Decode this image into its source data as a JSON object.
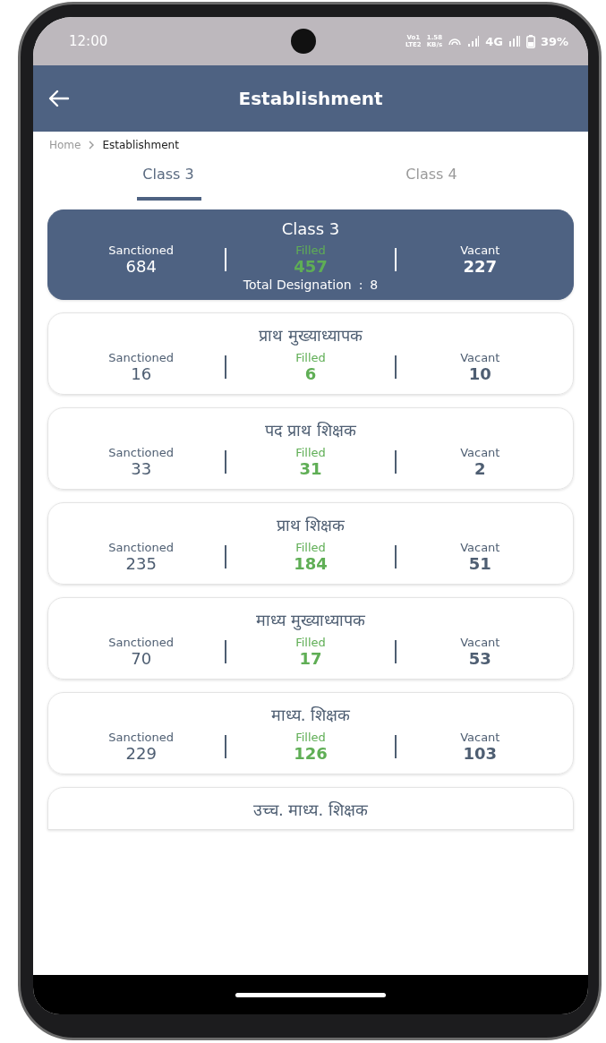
{
  "status_bar": {
    "time": "12:00",
    "volte_label": [
      "Vo1",
      "LTE2"
    ],
    "speed": [
      "1.58",
      "KB/s"
    ],
    "network_type": "4G",
    "battery": "39%"
  },
  "app_bar": {
    "title": "Establishment"
  },
  "breadcrumb": [
    {
      "label": "Home",
      "current": false
    },
    {
      "label": "Establishment",
      "current": true
    }
  ],
  "tabs": [
    {
      "label": "Class 3",
      "selected": true
    },
    {
      "label": "Class 4",
      "selected": false
    }
  ],
  "summary": {
    "title": "Class 3",
    "stats": [
      {
        "kind": "sanctioned",
        "label": "Sanctioned",
        "value": "684"
      },
      {
        "kind": "filled",
        "label": "Filled",
        "value": "457"
      },
      {
        "kind": "vacant",
        "label": "Vacant",
        "value": "227"
      }
    ],
    "total_label": "Total Designation",
    "total_separator": ":",
    "total_value": "8"
  },
  "designations": [
    {
      "title": "प्राथ मुख्याध्यापक",
      "stats": [
        {
          "kind": "sanctioned",
          "label": "Sanctioned",
          "value": "16"
        },
        {
          "kind": "filled",
          "label": "Filled",
          "value": "6"
        },
        {
          "kind": "vacant",
          "label": "Vacant",
          "value": "10"
        }
      ]
    },
    {
      "title": "पद प्राथ शिक्षक",
      "stats": [
        {
          "kind": "sanctioned",
          "label": "Sanctioned",
          "value": "33"
        },
        {
          "kind": "filled",
          "label": "Filled",
          "value": "31"
        },
        {
          "kind": "vacant",
          "label": "Vacant",
          "value": "2"
        }
      ]
    },
    {
      "title": "प्राथ शिक्षक",
      "stats": [
        {
          "kind": "sanctioned",
          "label": "Sanctioned",
          "value": "235"
        },
        {
          "kind": "filled",
          "label": "Filled",
          "value": "184"
        },
        {
          "kind": "vacant",
          "label": "Vacant",
          "value": "51"
        }
      ]
    },
    {
      "title": "माध्य मुख्याध्यापक",
      "stats": [
        {
          "kind": "sanctioned",
          "label": "Sanctioned",
          "value": "70"
        },
        {
          "kind": "filled",
          "label": "Filled",
          "value": "17"
        },
        {
          "kind": "vacant",
          "label": "Vacant",
          "value": "53"
        }
      ]
    },
    {
      "title": "माध्य. शिक्षक",
      "stats": [
        {
          "kind": "sanctioned",
          "label": "Sanctioned",
          "value": "229"
        },
        {
          "kind": "filled",
          "label": "Filled",
          "value": "126"
        },
        {
          "kind": "vacant",
          "label": "Vacant",
          "value": "103"
        }
      ]
    },
    {
      "title": "उच्च. माध्य. शिक्षक"
    }
  ]
}
